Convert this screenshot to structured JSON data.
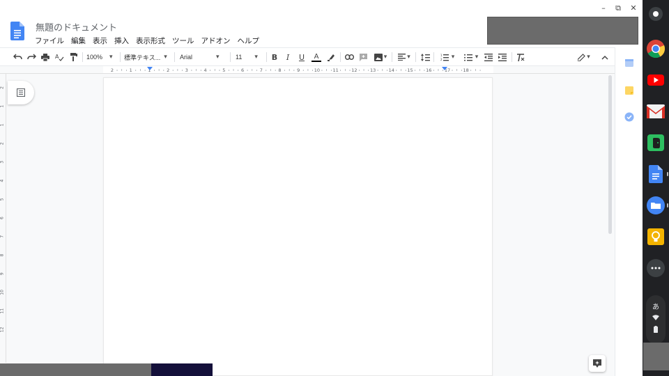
{
  "window": {
    "minimize_glyph": "–",
    "restore_glyph": "⧉",
    "close_glyph": "✕"
  },
  "document": {
    "title": "無題のドキュメント"
  },
  "menu": {
    "items": [
      {
        "label": "ファイル"
      },
      {
        "label": "編集"
      },
      {
        "label": "表示"
      },
      {
        "label": "挿入"
      },
      {
        "label": "表示形式"
      },
      {
        "label": "ツール"
      },
      {
        "label": "アドオン"
      },
      {
        "label": "ヘルプ"
      }
    ]
  },
  "toolbar": {
    "zoom": "100%",
    "style": "標準テキス...",
    "font": "Arial",
    "font_size": "11",
    "bold": "B",
    "italic": "I",
    "underline": "U",
    "text_color": "A",
    "dropdown_glyph": "▾"
  },
  "ruler": {
    "labels": [
      "2",
      "1",
      "1",
      "2",
      "3",
      "4",
      "5",
      "6",
      "7",
      "8",
      "9",
      "10",
      "11",
      "12",
      "13",
      "14",
      "15",
      "16",
      "17",
      "18"
    ]
  },
  "vruler": {
    "labels": [
      "2",
      "1",
      "1",
      "2",
      "3",
      "4",
      "5",
      "6",
      "7",
      "8",
      "9",
      "10",
      "11",
      "12"
    ]
  },
  "shelf": {
    "apps": [
      "chrome-icon",
      "youtube-icon",
      "gmail-icon",
      "evernote-icon",
      "docs-icon",
      "files-icon",
      "keep-icon",
      "more-icon"
    ],
    "ime_label": "あ"
  },
  "colors": {
    "docs_blue": "#4285f4",
    "shelf_bg": "#202124",
    "canvas_bg": "#f8f9fa",
    "redacted": "#6b6b6b"
  }
}
